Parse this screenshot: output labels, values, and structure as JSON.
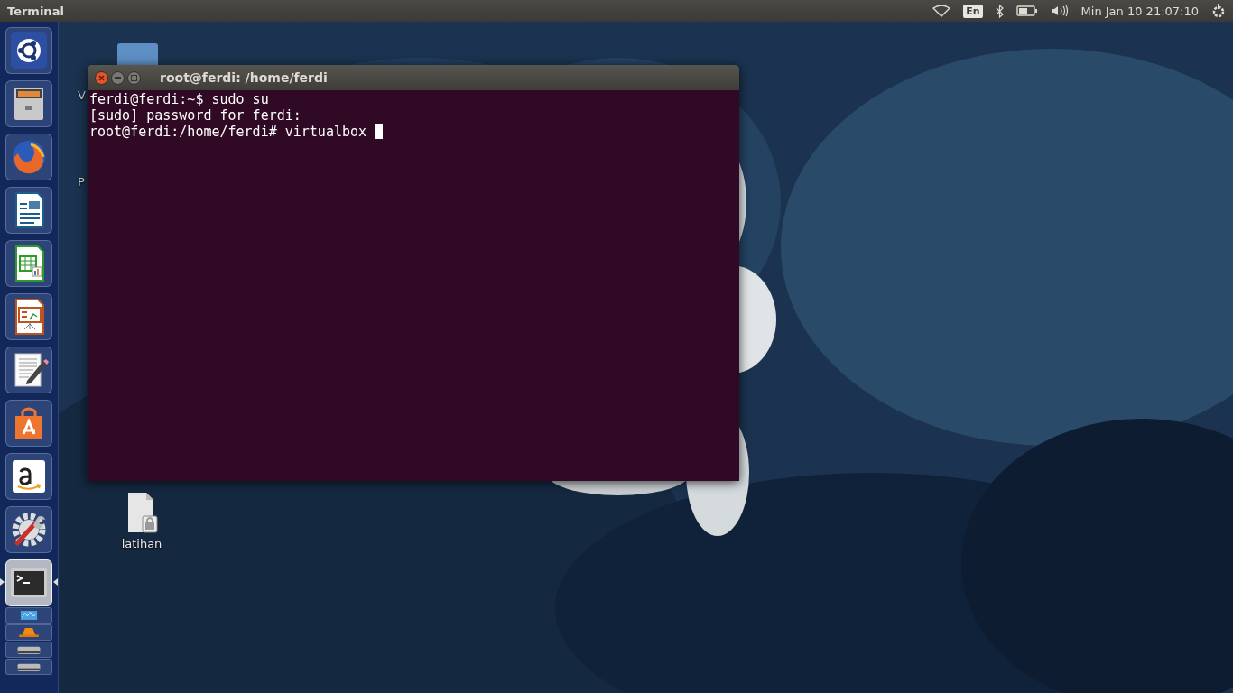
{
  "top_panel": {
    "app_title": "Terminal",
    "keyboard_layout": "En",
    "clock": "Min Jan 10 21:07:10"
  },
  "launcher": {
    "items": [
      {
        "kind": "dash",
        "active": false
      },
      {
        "kind": "files",
        "active": false
      },
      {
        "kind": "browser",
        "active": false
      },
      {
        "kind": "writer",
        "active": false
      },
      {
        "kind": "calc",
        "active": false
      },
      {
        "kind": "impress",
        "active": false
      },
      {
        "kind": "editor",
        "active": false
      },
      {
        "kind": "store",
        "active": false
      },
      {
        "kind": "amazon",
        "active": false
      },
      {
        "kind": "settings",
        "active": false
      },
      {
        "kind": "terminal",
        "active": true
      }
    ],
    "folded_items": [
      {
        "kind": "monitor"
      },
      {
        "kind": "cone"
      },
      {
        "kind": "drive"
      },
      {
        "kind": "drive"
      }
    ]
  },
  "desktop": {
    "label_fragments": [
      "V",
      "P"
    ],
    "icons": [
      {
        "kind": "locked-file",
        "label": "latihan"
      }
    ]
  },
  "terminal_window": {
    "title": "root@ferdi: /home/ferdi",
    "lines": [
      "ferdi@ferdi:~$ sudo su",
      "[sudo] password for ferdi:",
      "root@ferdi:/home/ferdi# virtualbox "
    ],
    "cursor": true
  }
}
